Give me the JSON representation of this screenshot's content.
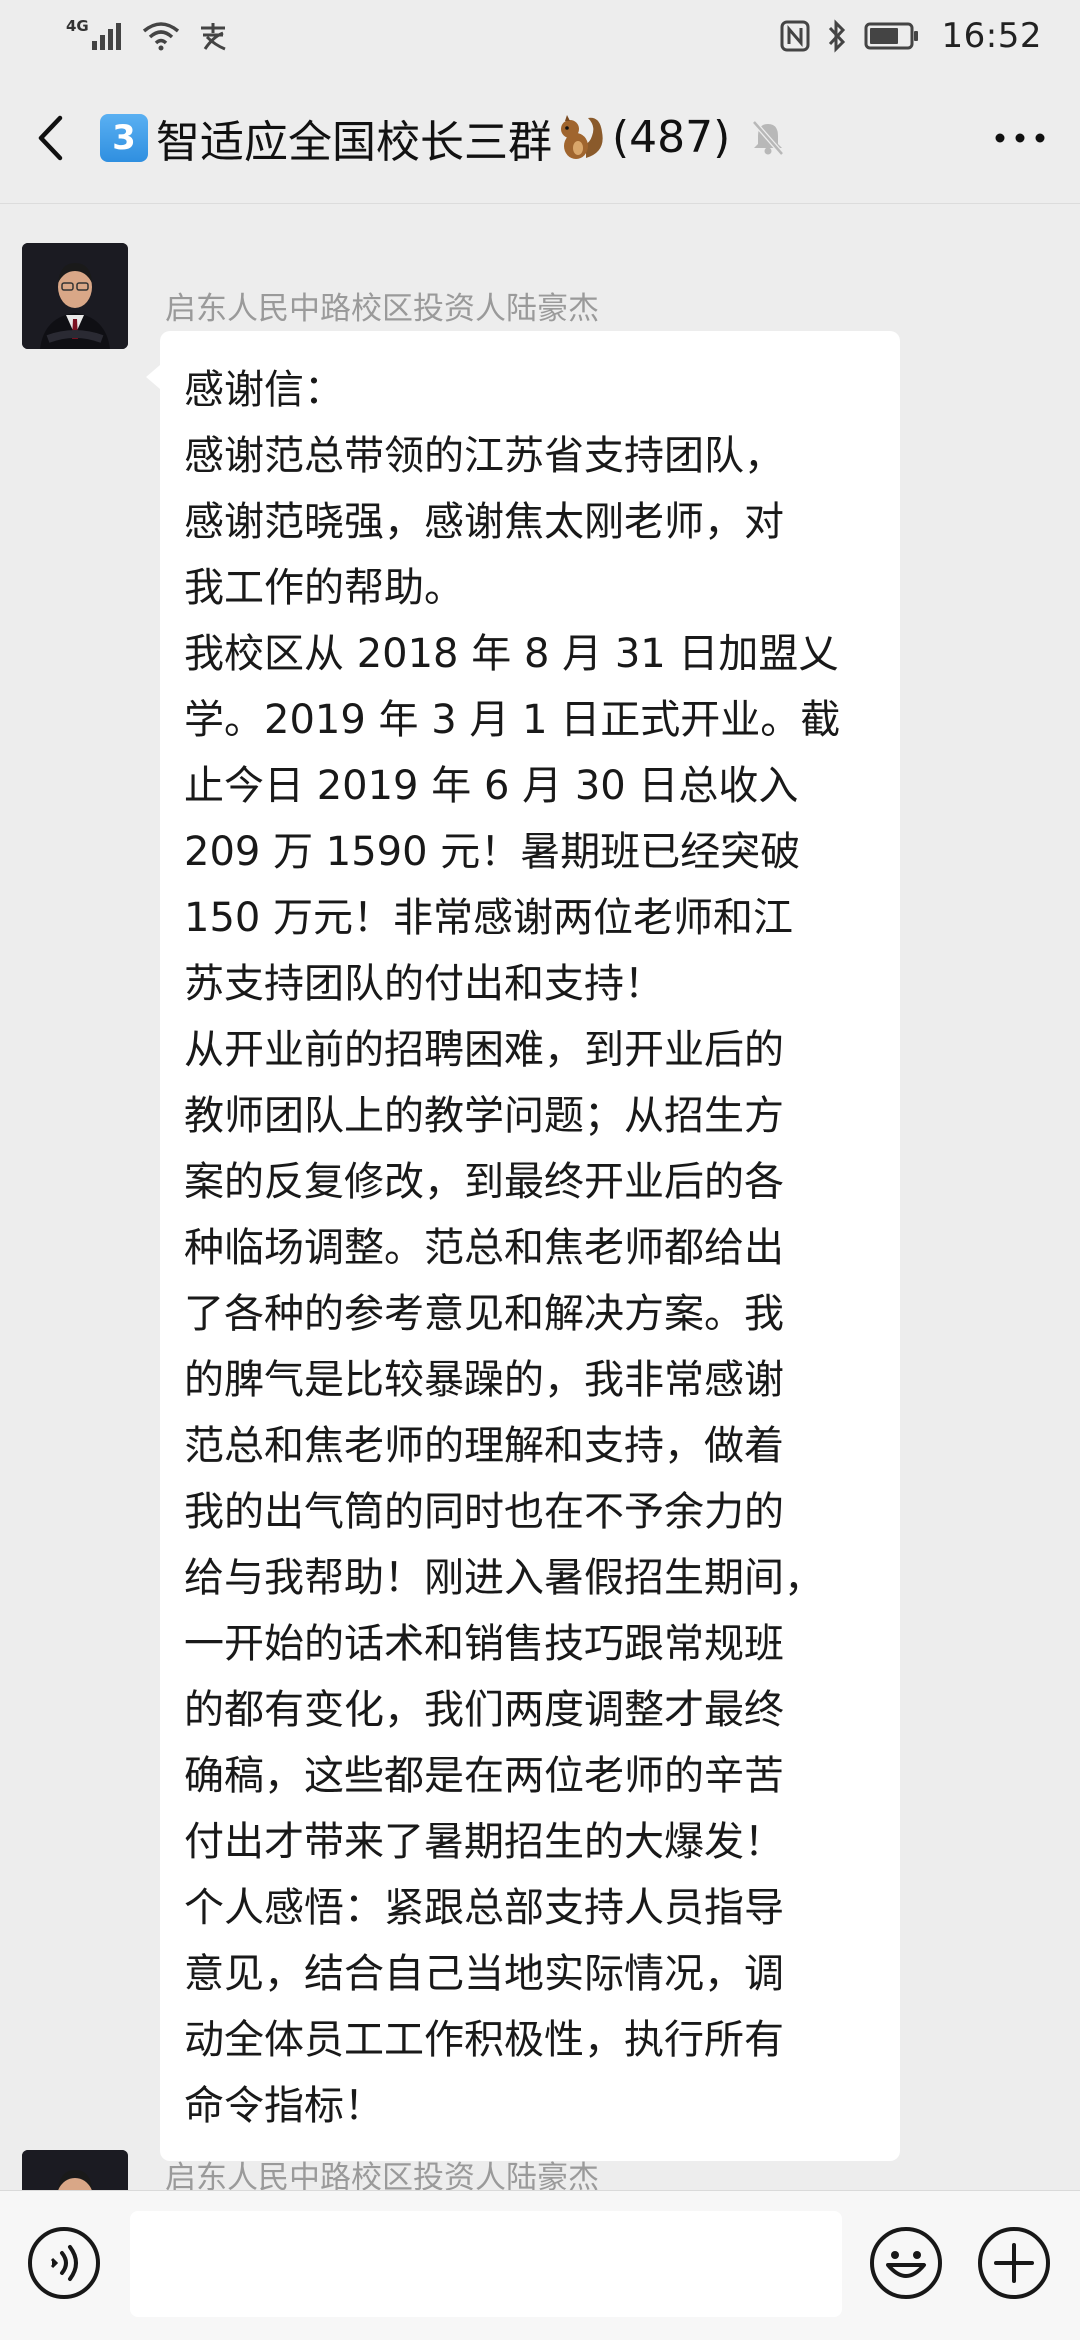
{
  "status_bar": {
    "network_label": "4G",
    "time": "16:52",
    "icons": [
      "signal-icon",
      "wifi-icon",
      "payment-icon",
      "nfc-icon",
      "bluetooth-icon",
      "battery-icon"
    ]
  },
  "header": {
    "group_number_badge": "3",
    "title": "智适应全国校长三群",
    "member_count": "(487)",
    "icons": [
      "back-icon",
      "squirrel-emoji-icon",
      "mute-bell-icon",
      "more-icon"
    ]
  },
  "messages": [
    {
      "sender": "启东人民中路校区投资人陆豪杰",
      "lines": [
        "感谢信：",
        "感谢范总带领的江苏省支持团队，",
        "感谢范晓强，感谢焦太刚老师，对",
        "我工作的帮助。",
        "我校区从 2018 年 8 月 31 日加盟乂",
        "学。2019 年 3 月 1 日正式开业。截",
        "止今日 2019 年 6 月 30 日总收入",
        "209 万 1590 元！暑期班已经突破",
        "150 万元！非常感谢两位老师和江",
        "苏支持团队的付出和支持！",
        "从开业前的招聘困难，到开业后的",
        "教师团队上的教学问题；从招生方",
        "案的反复修改，到最终开业后的各",
        "种临场调整。范总和焦老师都给出",
        "了各种的参考意见和解决方案。我",
        "的脾气是比较暴躁的，我非常感谢",
        "范总和焦老师的理解和支持，做着",
        "我的出气筒的同时也在不予余力的",
        "给与我帮助！刚进入暑假招生期间，",
        "一开始的话术和销售技巧跟常规班",
        "的都有变化，我们两度调整才最终",
        "确稿，这些都是在两位老师的辛苦",
        "付出才带来了暑期招生的大爆发！",
        "个人感悟：紧跟总部支持人员指导",
        "意见，结合自己当地实际情况，调",
        "动全体员工工作积极性，执行所有",
        "命令指标！"
      ]
    },
    {
      "sender": "启东人民中路校区投资人陆豪杰",
      "lines": []
    }
  ],
  "input_bar": {
    "value": "",
    "icons": [
      "voice-icon",
      "emoji-icon",
      "plus-icon"
    ]
  },
  "colors": {
    "background": "#EDEDED",
    "bubble": "#FFFFFF",
    "sender_name": "#9A9A9A",
    "badge": "#3A97E6"
  }
}
